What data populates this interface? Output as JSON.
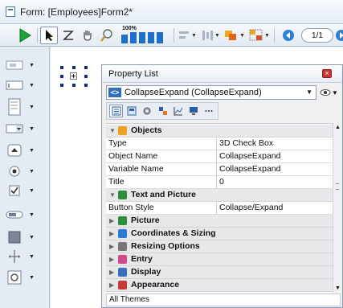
{
  "window": {
    "title": "Form: [Employees]Form2*"
  },
  "toolbar": {
    "zoom_label": "100%",
    "page_indicator": "1/1",
    "buttons": [
      {
        "name": "run-icon"
      },
      {
        "name": "arrow-select-icon"
      },
      {
        "name": "reorder-icon"
      },
      {
        "name": "hand-icon"
      },
      {
        "name": "zoom-icon"
      },
      {
        "name": "zoom-level-icon"
      },
      {
        "name": "align-icon"
      },
      {
        "name": "distribute-icon"
      },
      {
        "name": "level-icon"
      },
      {
        "name": "group-icon"
      },
      {
        "name": "prev-page-icon"
      },
      {
        "name": "next-page-icon"
      }
    ]
  },
  "palette": {
    "items": [
      {
        "name": "text-tool-icon"
      },
      {
        "name": "field-tool-icon"
      },
      {
        "name": "list-tool-icon"
      },
      {
        "name": "combo-tool-icon"
      },
      {
        "name": "button-tool-icon"
      },
      {
        "name": "radio-tool-icon"
      },
      {
        "name": "checkbox-tool-icon"
      },
      {
        "name": "indicator-tool-icon"
      },
      {
        "name": "rectangle-tool-icon"
      },
      {
        "name": "splitter-tool-icon"
      },
      {
        "name": "plugin-tool-icon"
      }
    ]
  },
  "property_list": {
    "title": "Property List",
    "close_symbol": "×",
    "selected_object": "CollapseExpand (CollapseExpand)",
    "selected_icon_text": "<>",
    "footer": "All Themes",
    "tabs": [
      {
        "name": "list-view-icon"
      },
      {
        "name": "form-view-icon"
      },
      {
        "name": "gear-view-icon"
      },
      {
        "name": "objects-view-icon"
      },
      {
        "name": "chart-view-icon"
      },
      {
        "name": "monitor-view-icon"
      },
      {
        "name": "more-view-icon"
      }
    ],
    "rows": [
      {
        "kind": "cat",
        "expanded": true,
        "label": "Objects",
        "icon": "objects-category-icon",
        "color": "#f0a020"
      },
      {
        "kind": "prop",
        "key": "Type",
        "value": "3D Check Box"
      },
      {
        "kind": "prop",
        "key": "Object Name",
        "value": "CollapseExpand"
      },
      {
        "kind": "prop",
        "key": "Variable Name",
        "value": "CollapseExpand"
      },
      {
        "kind": "prop",
        "key": "Title",
        "value": "0"
      },
      {
        "kind": "cat",
        "expanded": true,
        "label": "Text and Picture",
        "icon": "text-picture-icon",
        "color": "#2e8b3a"
      },
      {
        "kind": "prop",
        "key": "Button Style",
        "value": "Collapse/Expand"
      },
      {
        "kind": "cat",
        "expanded": false,
        "label": "Picture",
        "icon": "picture-icon",
        "color": "#2e8b3a"
      },
      {
        "kind": "cat",
        "expanded": false,
        "label": "Coordinates & Sizing",
        "icon": "coordinates-icon",
        "color": "#2a7ad8"
      },
      {
        "kind": "cat",
        "expanded": false,
        "label": "Resizing Options",
        "icon": "resizing-icon",
        "color": "#777777"
      },
      {
        "kind": "cat",
        "expanded": false,
        "label": "Entry",
        "icon": "entry-icon",
        "color": "#d04a8a"
      },
      {
        "kind": "cat",
        "expanded": false,
        "label": "Display",
        "icon": "display-icon",
        "color": "#3a6fc0"
      },
      {
        "kind": "cat",
        "expanded": false,
        "label": "Appearance",
        "icon": "appearance-icon",
        "color": "#c83a3a"
      }
    ]
  }
}
